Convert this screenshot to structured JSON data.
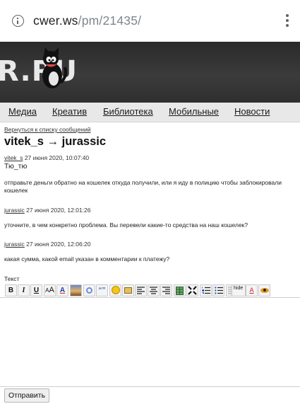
{
  "browser": {
    "url_host": "cwer.ws",
    "url_path": "/pm/21435/"
  },
  "banner": {
    "logo_text": "R.RU"
  },
  "nav": {
    "items": [
      "Медиа",
      "Креатив",
      "Библиотека",
      "Мобильные",
      "Новости"
    ]
  },
  "page": {
    "back_link": "Вернуться к списку сообщений",
    "title": "vitek_s → jurassic"
  },
  "messages": [
    {
      "author": "vitek_s",
      "date": " 27 июня 2020, 10:07:40",
      "subject": "Тю_тю",
      "text": "отправьте деньги обратно на кошелек откуда получили, или я иду в полицию чтобы заблокировали кошелек"
    },
    {
      "author": "jurassic",
      "date": " 27 июня 2020, 12:01:26",
      "text": "уточните, в чем конкретно проблема. Вы перевели какие-то средства на наш кошелек?"
    },
    {
      "author": "jurassic",
      "date": " 27 июня 2020, 12:06:20",
      "text": "какая сумма, какой email указан в комментарии к платежу?"
    }
  ],
  "form": {
    "label": "Текст",
    "submit_label": "Отправить",
    "textarea_value": ""
  },
  "toolbar": {
    "bold": "B",
    "italic": "I",
    "underline": "U",
    "hide": "hide",
    "quote": "“”"
  }
}
